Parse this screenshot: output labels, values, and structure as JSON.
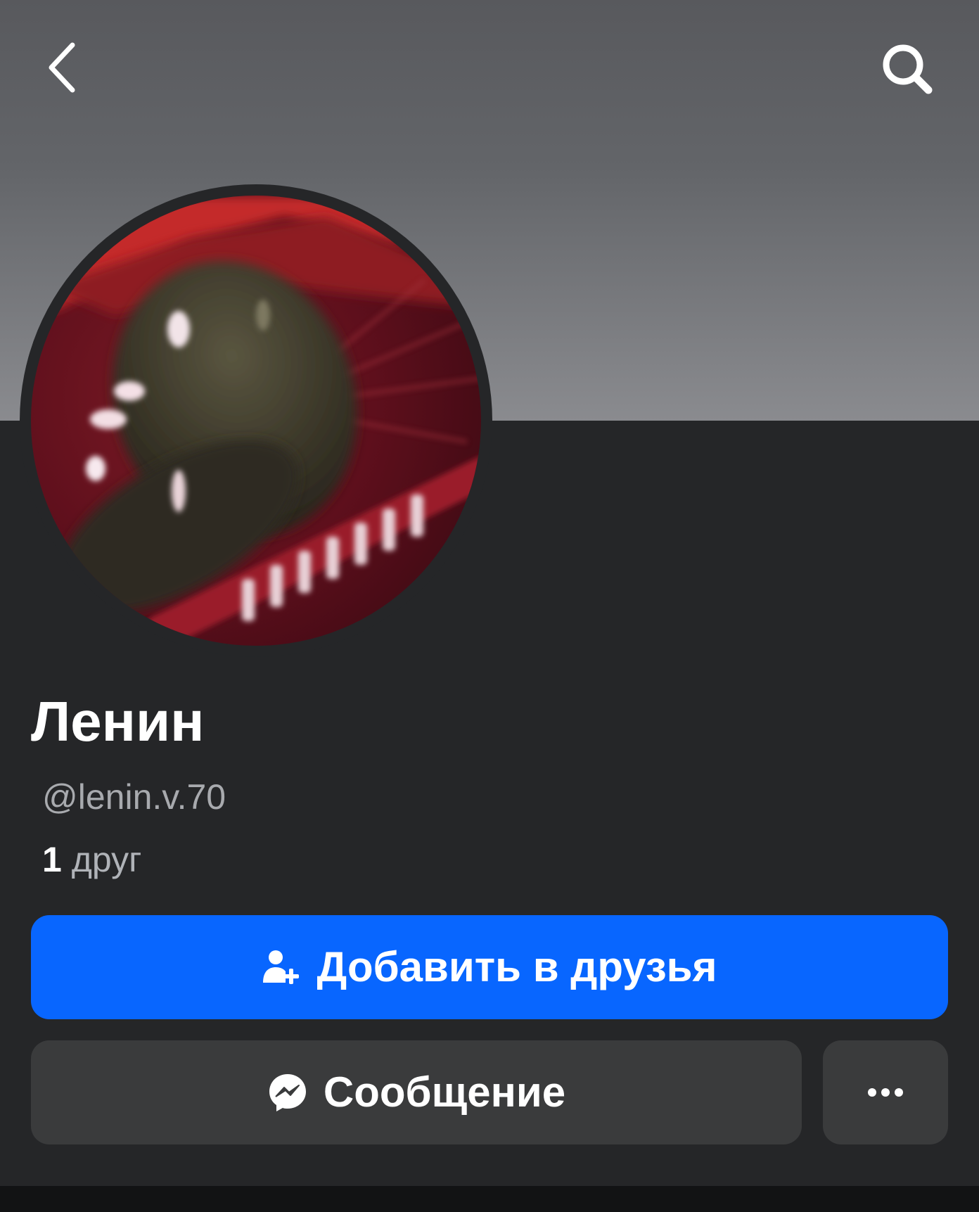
{
  "profile": {
    "name": "Ленин",
    "handle": "@lenin.v.70",
    "friends_count": "1",
    "friends_label": "друг"
  },
  "actions": {
    "add_friend_label": "Добавить в друзья",
    "message_label": "Сообщение"
  },
  "icons": {
    "back": "chevron-left-icon",
    "search": "search-icon",
    "add_friend": "add-person-icon",
    "messenger": "messenger-icon",
    "more": "more-dots-icon"
  },
  "colors": {
    "primary_button": "#0866ff",
    "secondary_button": "#3a3b3c",
    "background": "#252628"
  }
}
